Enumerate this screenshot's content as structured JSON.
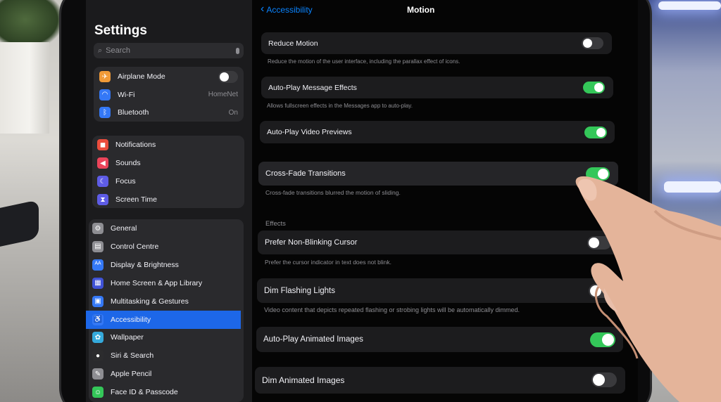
{
  "sidebar": {
    "title": "Settings",
    "search_placeholder": "Search",
    "group1": [
      {
        "label": "Airplane Mode",
        "icon": "airplane-icon",
        "color": "#f19a37",
        "glyph": "✈",
        "value": "",
        "toggle": "off"
      },
      {
        "label": "Wi-Fi",
        "icon": "wifi-icon",
        "color": "#3478f6",
        "glyph": "◠",
        "value": "HomeNet"
      },
      {
        "label": "Bluetooth",
        "icon": "bluetooth-icon",
        "color": "#3478f6",
        "glyph": "ᛒ",
        "value": "On"
      }
    ],
    "group2": [
      {
        "label": "Notifications",
        "icon": "bell-icon",
        "color": "#eb4d3d",
        "glyph": "◼"
      },
      {
        "label": "Sounds",
        "icon": "speaker-icon",
        "color": "#eb445a",
        "glyph": "◀"
      },
      {
        "label": "Focus",
        "icon": "moon-icon",
        "color": "#5e5ce6",
        "glyph": "☾"
      },
      {
        "label": "Screen Time",
        "icon": "hourglass-icon",
        "color": "#5e5ce6",
        "glyph": "⧗"
      }
    ],
    "group3": [
      {
        "label": "General",
        "icon": "gear-icon",
        "color": "#8e8e93",
        "glyph": "⚙"
      },
      {
        "label": "Control Centre",
        "icon": "sliders-icon",
        "color": "#8e8e93",
        "glyph": "▤"
      },
      {
        "label": "Display & Brightness",
        "icon": "brightness-icon",
        "color": "#3478f6",
        "glyph": "ᴬᴬ"
      },
      {
        "label": "Home Screen & App Library",
        "icon": "grid-icon",
        "color": "#3f52d6",
        "glyph": "▦"
      },
      {
        "label": "Multitasking & Gestures",
        "icon": "multitasking-icon",
        "color": "#3478f6",
        "glyph": "▣"
      },
      {
        "label": "Accessibility",
        "icon": "accessibility-icon",
        "color": "#3478f6",
        "glyph": "♿",
        "active": true
      },
      {
        "label": "Wallpaper",
        "icon": "flower-icon",
        "color": "#35aadc",
        "glyph": "✿"
      },
      {
        "label": "Siri & Search",
        "icon": "siri-icon",
        "color": "#2c2c2e",
        "glyph": "●"
      },
      {
        "label": "Apple Pencil",
        "icon": "pencil-icon",
        "color": "#8e8e93",
        "glyph": "✎"
      },
      {
        "label": "Face ID & Passcode",
        "icon": "faceid-icon",
        "color": "#34c759",
        "glyph": "☺"
      }
    ]
  },
  "nav": {
    "back_label": "Accessibility",
    "title": "Motion"
  },
  "motion": {
    "reduce_motion": {
      "label": "Reduce Motion",
      "on": false
    },
    "reduce_motion_footer": "Reduce the motion of the user interface, including the parallax effect of icons.",
    "auto_play_message": {
      "label": "Auto-Play Message Effects",
      "on": true
    },
    "auto_play_message_footer": "Allows fullscreen effects in the Messages app to auto-play.",
    "auto_play_video": {
      "label": "Auto-Play Video Previews",
      "on": true
    },
    "cross_fade": {
      "label": "Cross-Fade Transitions",
      "on": true
    },
    "cross_fade_footer": "Cross-fade transitions blurred the motion of sliding.",
    "effects_header": "Effects",
    "non_blinking": {
      "label": "Prefer Non-Blinking Cursor",
      "on": false
    },
    "non_blinking_footer": "Prefer the cursor indicator in text does not blink.",
    "dim_flashing": {
      "label": "Dim Flashing Lights",
      "on": false
    },
    "dim_flashing_footer": "Video content that depicts repeated flashing or strobing lights will be automatically dimmed.",
    "auto_play_images": {
      "label": "Auto-Play Animated Images",
      "on": true
    },
    "dim_animated": {
      "label": "Dim Animated Images",
      "on": false
    }
  },
  "colors": {
    "accent": "#0a84ff",
    "switch_on": "#34c759",
    "selected_row": "#1d67e8"
  }
}
